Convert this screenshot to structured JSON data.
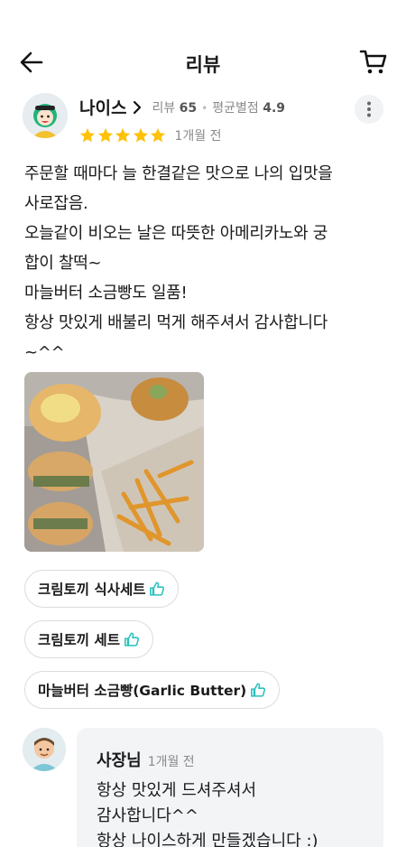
{
  "header": {
    "title": "리뷰",
    "back_icon": "arrow-left-icon",
    "cart_icon": "cart-icon"
  },
  "review": {
    "nickname": "나이스",
    "review_count_label": "리뷰",
    "review_count": "65",
    "avg_rating_label": "평균별점",
    "avg_rating": "4.9",
    "stars": 5,
    "star_color": "#ffc107",
    "time": "1개월 전",
    "text_lines": [
      "주문할 때마다 늘 한결같은 맛으로 나의 입맛을",
      "사로잡음.",
      "오늘같이 비오는 날은 따뜻한 아메리카노와 궁",
      "합이 찰떡~",
      "마늘버터 소금빵도 일품!",
      "항상 맛있게 배불리 먹게 해주셔서 감사합니다",
      "~^^"
    ],
    "menu_tags": [
      "크림토끼 식사세트",
      "크림토끼 세트",
      "마늘버터 소금빵(Garlic Butter)"
    ],
    "accent_color": "#2ac1bc"
  },
  "reply": {
    "owner_name": "사장님",
    "time": "1개월 전",
    "text_lines": [
      "항상 맛있게 드셔주셔서",
      "감사합니다^^",
      "항상 나이스하게 만들겠습니다 :)"
    ]
  }
}
